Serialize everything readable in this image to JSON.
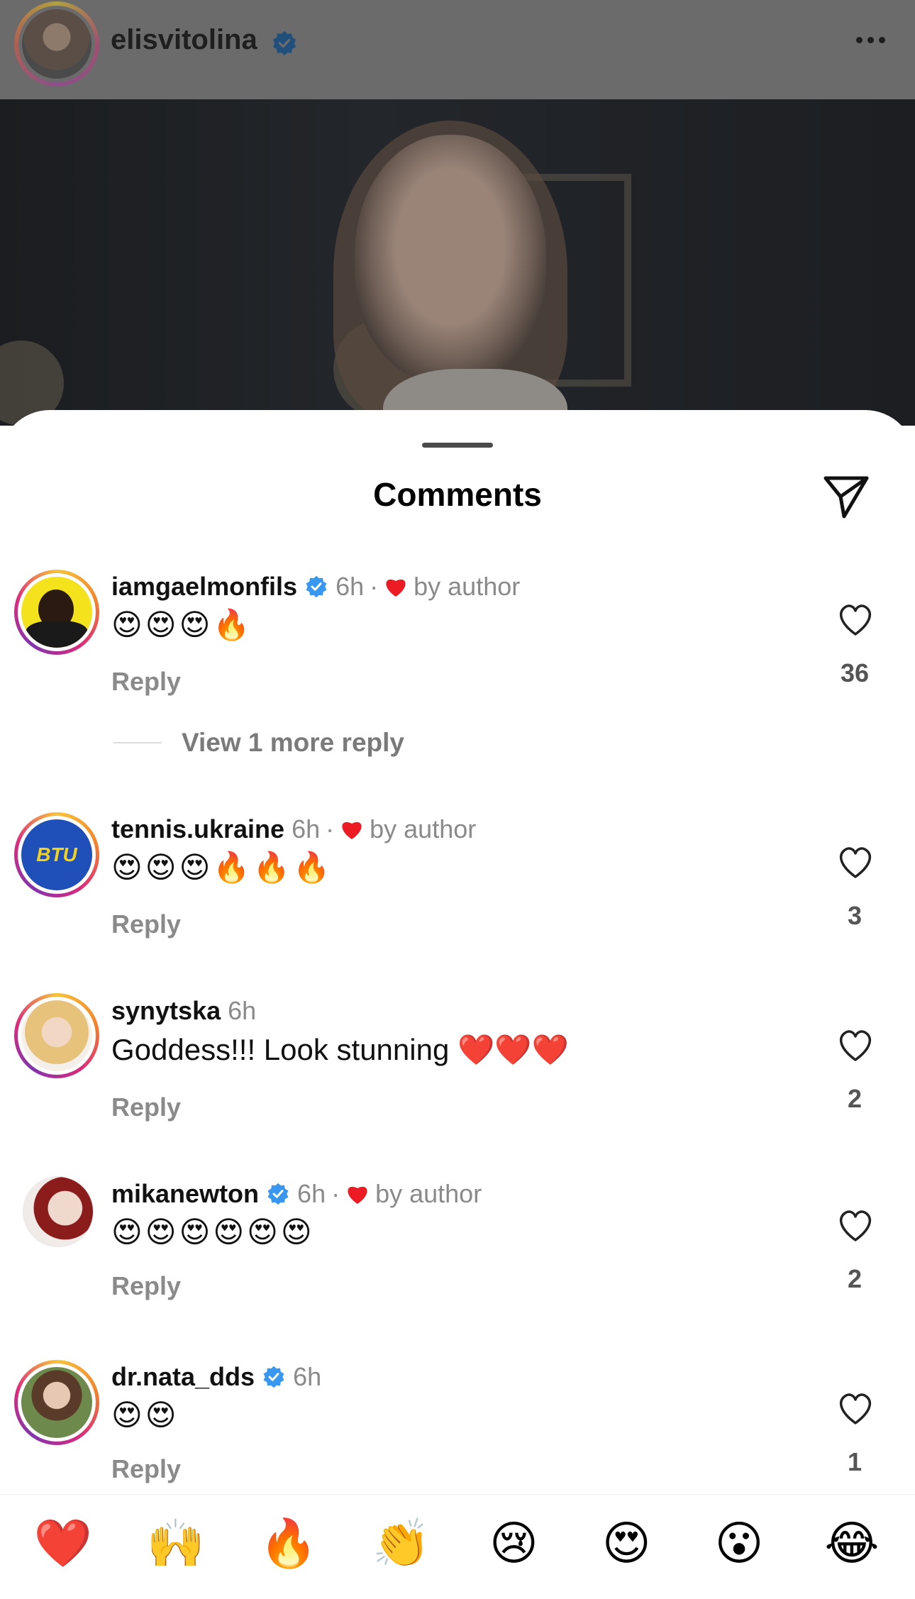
{
  "post": {
    "username": "elisvitolina"
  },
  "sheet": {
    "title": "Comments"
  },
  "comments": [
    {
      "username": "iamgaelmonfils",
      "verified": true,
      "time": "6h",
      "liked_by_author": true,
      "by_author_label": "by author",
      "text": "😍😍😍🔥",
      "reply_label": "Reply",
      "likes": "36"
    },
    {
      "username": "tennis.ukraine",
      "verified": false,
      "time": "6h",
      "liked_by_author": true,
      "by_author_label": "by author",
      "text": "😍😍😍🔥🔥🔥",
      "reply_label": "Reply",
      "likes": "3",
      "avatar_text": "BTU"
    },
    {
      "username": "synytska",
      "verified": false,
      "time": "6h",
      "liked_by_author": false,
      "text": "Goddess!!! Look stunning ❤️❤️❤️",
      "reply_label": "Reply",
      "likes": "2"
    },
    {
      "username": "mikanewton",
      "verified": true,
      "time": "6h",
      "liked_by_author": true,
      "by_author_label": "by author",
      "text": "😍😍😍😍😍😍",
      "reply_label": "Reply",
      "likes": "2"
    },
    {
      "username": "dr.nata_dds",
      "verified": true,
      "time": "6h",
      "liked_by_author": false,
      "text": "😍😍",
      "reply_label": "Reply",
      "likes": "1"
    }
  ],
  "view_more": {
    "label": "View 1 more reply"
  },
  "emoji_bar": [
    "❤️",
    "🙌",
    "🔥",
    "👏",
    "😢",
    "😍",
    "😮",
    "😂"
  ],
  "colors": {
    "verified_blue": "#3897f0",
    "heart_red": "#ed1c24",
    "muted_text": "#8a8a8a"
  }
}
